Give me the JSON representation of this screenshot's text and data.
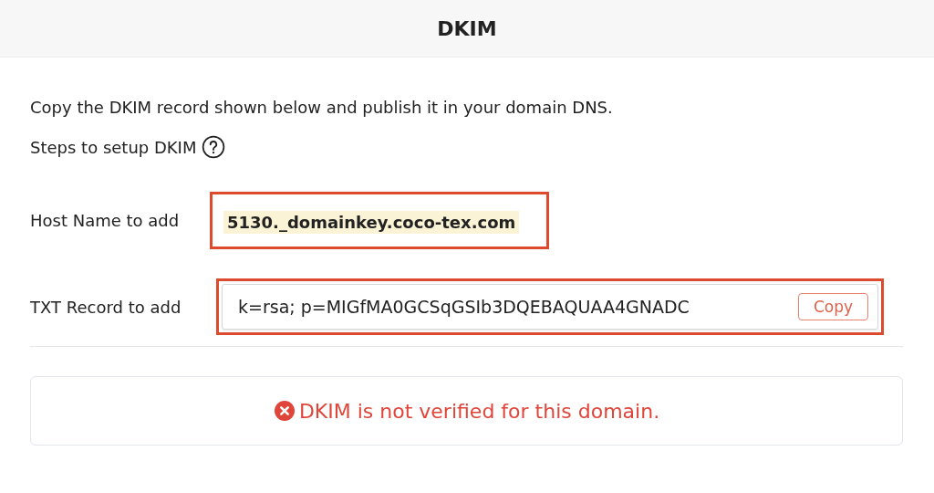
{
  "header": {
    "title": "DKIM"
  },
  "intro": "Copy the DKIM record shown below and publish it in your domain DNS.",
  "steps_link": "Steps to setup DKIM",
  "records": [
    {
      "kind": "host",
      "label": "Host Name to add",
      "value": "5130._domainkey.coco-tex.com",
      "highlighted": true
    },
    {
      "kind": "txt",
      "label": "TXT Record to add",
      "value": "k=rsa; p=MIGfMA0GCSqGSIb3DQEBAQUAA4GNADC",
      "button": "Copy",
      "highlighted": true
    }
  ],
  "status": {
    "verified": false,
    "message": "DKIM is not verified for this domain."
  }
}
